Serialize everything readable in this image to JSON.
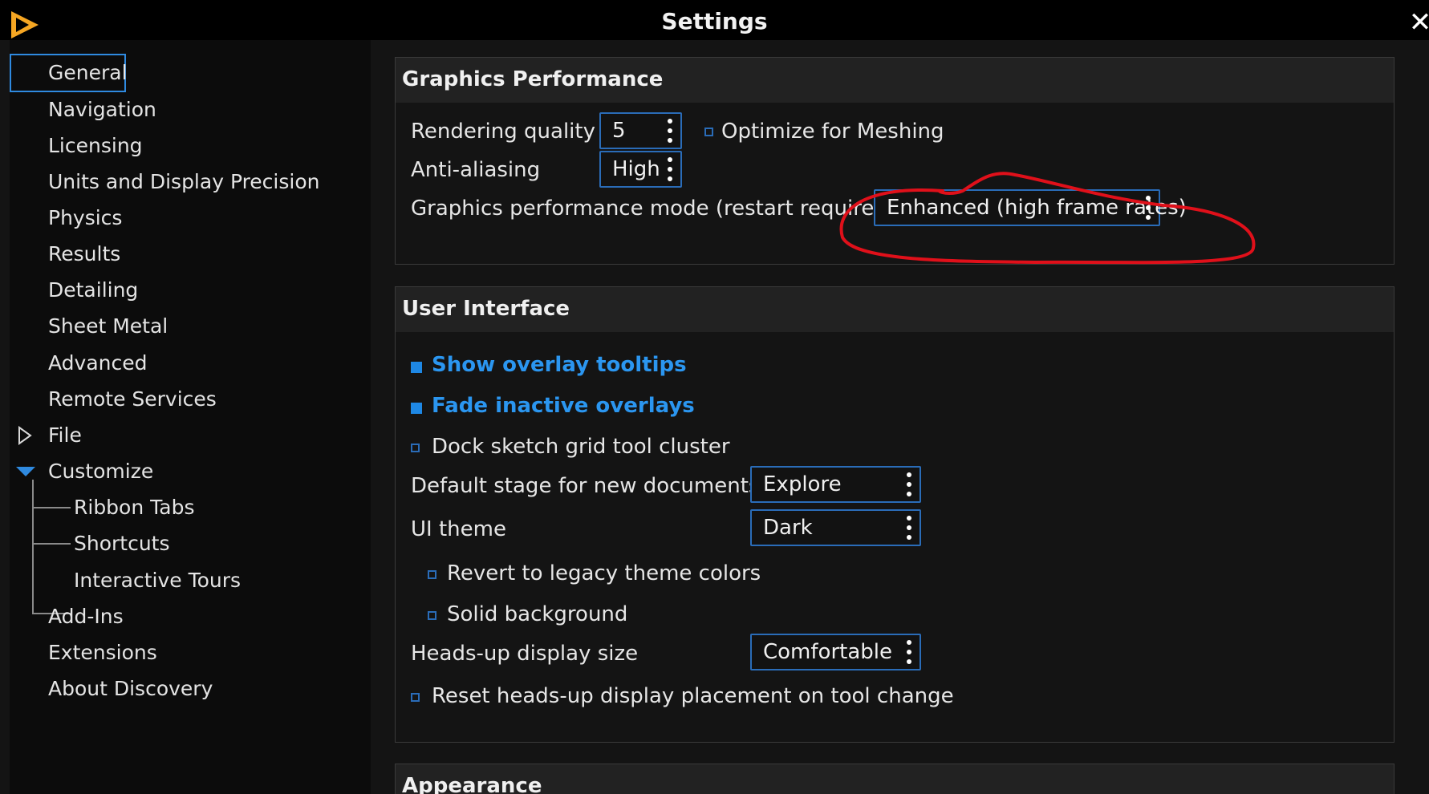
{
  "window": {
    "title": "Settings",
    "close_glyph": "✕"
  },
  "sidebar": {
    "items": [
      {
        "label": "General"
      },
      {
        "label": "Navigation"
      },
      {
        "label": "Licensing"
      },
      {
        "label": "Units and Display Precision"
      },
      {
        "label": "Physics"
      },
      {
        "label": "Results"
      },
      {
        "label": "Detailing"
      },
      {
        "label": "Sheet Metal"
      },
      {
        "label": "Advanced"
      },
      {
        "label": "Remote Services"
      },
      {
        "label": "File"
      },
      {
        "label": "Customize"
      },
      {
        "label": "Ribbon Tabs"
      },
      {
        "label": "Shortcuts"
      },
      {
        "label": "Interactive Tours"
      },
      {
        "label": "Add-Ins"
      },
      {
        "label": "Extensions"
      },
      {
        "label": "About Discovery"
      }
    ]
  },
  "graphics": {
    "header": "Graphics Performance",
    "rendering_quality": {
      "label": "Rendering quality",
      "value": "5"
    },
    "optimize_meshing": {
      "label": "Optimize for Meshing",
      "checked": false
    },
    "anti_aliasing": {
      "label": "Anti-aliasing",
      "value": "High"
    },
    "performance_mode": {
      "label": "Graphics performance mode (restart required)",
      "value": "Enhanced (high frame rates)"
    }
  },
  "ui": {
    "header": "User Interface",
    "show_overlay_tooltips": {
      "label": "Show overlay tooltips",
      "checked": true
    },
    "fade_inactive_overlays": {
      "label": "Fade inactive overlays",
      "checked": true
    },
    "dock_sketch_grid": {
      "label": "Dock sketch grid tool cluster",
      "checked": false
    },
    "default_stage": {
      "label": "Default stage for new documents",
      "value": "Explore"
    },
    "ui_theme": {
      "label": "UI theme",
      "value": "Dark"
    },
    "revert_legacy": {
      "label": "Revert to legacy theme colors",
      "checked": false
    },
    "solid_background": {
      "label": "Solid background",
      "checked": false
    },
    "hud_size": {
      "label": "Heads-up display size",
      "value": "Comfortable"
    },
    "reset_hud": {
      "label": "Reset heads-up display placement on tool change",
      "checked": false
    }
  },
  "appearance": {
    "header": "Appearance"
  },
  "colors": {
    "accent": "#2f8ae0",
    "checked_text": "#2b96f0",
    "annotation": "#e0101a",
    "logo": "#f5a623"
  }
}
